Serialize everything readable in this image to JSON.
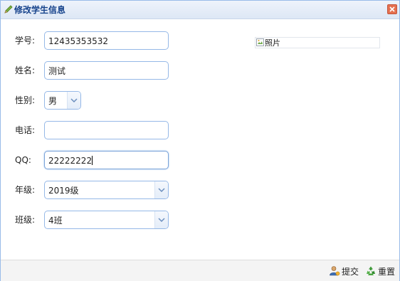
{
  "dialog": {
    "title": "修改学生信息",
    "icon": "edit-pencil-icon",
    "close_icon": "close-icon"
  },
  "form": {
    "student_id": {
      "label": "学号:",
      "value": "12435353532"
    },
    "name": {
      "label": "姓名:",
      "value": "测试"
    },
    "gender": {
      "label": "性别:",
      "value": "男"
    },
    "phone": {
      "label": "电话:",
      "value": ""
    },
    "qq": {
      "label": "QQ:",
      "value": "22222222"
    },
    "grade": {
      "label": "年级:",
      "value": "2019级"
    },
    "class": {
      "label": "班级:",
      "value": "4班"
    }
  },
  "photo": {
    "alt": "照片",
    "icon": "broken-image-icon"
  },
  "footer": {
    "submit_label": "提交",
    "submit_icon": "user-submit-icon",
    "reset_label": "重置",
    "reset_icon": "recycle-reset-icon"
  },
  "colors": {
    "title_text": "#15428b",
    "field_border": "#95b8e7",
    "dialog_border": "#99bbe8",
    "close_button": "#e5704f"
  }
}
